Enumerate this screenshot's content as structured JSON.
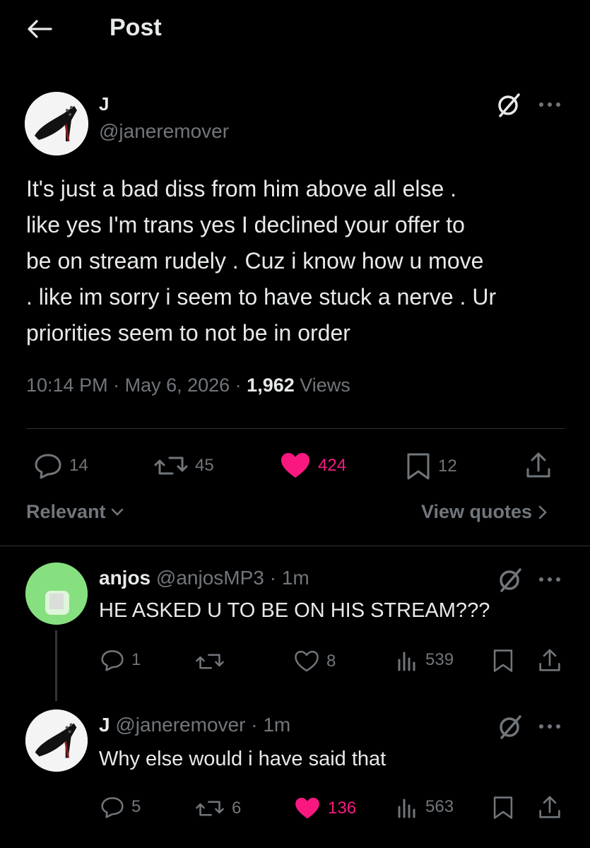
{
  "header": {
    "title": "Post"
  },
  "post": {
    "author_name": "J",
    "author_handle": "@janeremover",
    "text": "It's just a bad diss from him above all else .\nlike yes I'm trans yes I declined your offer to\nbe on stream rudely . Cuz i know how u move\n. like im sorry i seem to have stuck a nerve . Ur\npriorities seem to not be in order",
    "time": "10:14 PM",
    "date": "May 6, 2026",
    "views_count": "1,962",
    "views_label": "Views",
    "actions": {
      "replies": "14",
      "reposts": "45",
      "likes": "424",
      "bookmarks": "12"
    }
  },
  "sort": {
    "label": "Relevant",
    "view_quotes": "View quotes"
  },
  "replies": [
    {
      "name": "anjos",
      "handle": "@anjosMP3",
      "time": "1m",
      "text": "HE ASKED U TO BE ON HIS STREAM???",
      "actions": {
        "replies": "1",
        "reposts": "",
        "likes": "8",
        "views": "539"
      }
    },
    {
      "name": "J",
      "handle": "@janeremover",
      "time": "1m",
      "text": "Why else would i have said that",
      "actions": {
        "replies": "5",
        "reposts": "6",
        "likes": "136",
        "views": "563"
      }
    }
  ],
  "colors": {
    "like_active": "#f91880",
    "muted": "#71767b",
    "divider": "#2f3336",
    "background": "#000000"
  },
  "icons": [
    "back-arrow-icon",
    "grok-icon",
    "more-icon",
    "reply-icon",
    "repost-icon",
    "heart-icon",
    "bookmark-icon",
    "share-icon",
    "views-icon",
    "chevron-down-icon",
    "chevron-right-icon"
  ]
}
